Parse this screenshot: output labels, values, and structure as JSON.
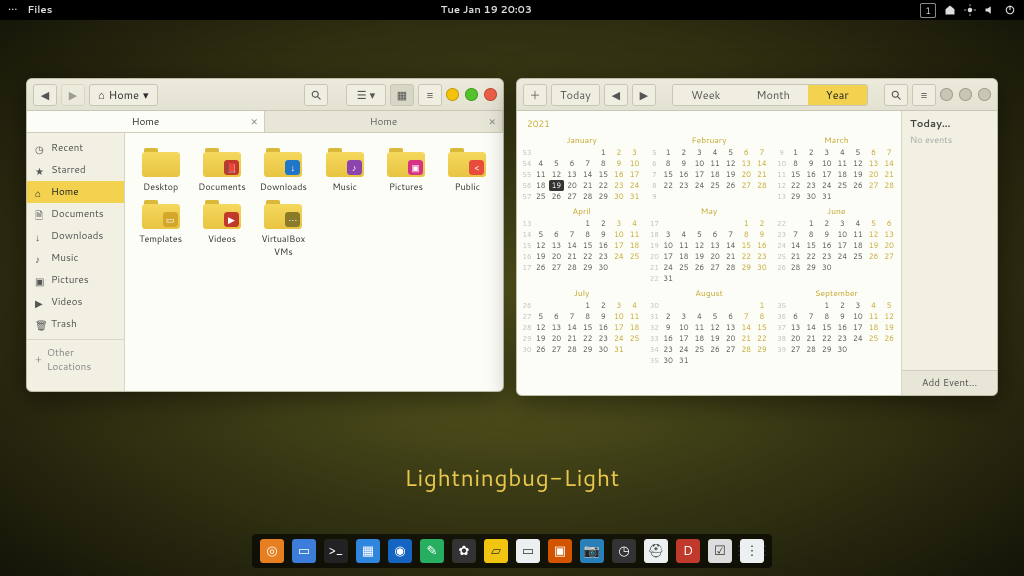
{
  "topbar": {
    "activities": "•••",
    "app": "Files",
    "clock": "Tue Jan 19  20:03",
    "workspace": "1"
  },
  "theme_name": "Lightningbug-Light",
  "files": {
    "path_label": "Home",
    "tabs": [
      {
        "label": "Home",
        "active": true
      },
      {
        "label": "Home",
        "active": false
      }
    ],
    "sidebar": [
      {
        "label": "Recent",
        "icon": "clock"
      },
      {
        "label": "Starred",
        "icon": "star"
      },
      {
        "label": "Home",
        "icon": "home",
        "selected": true
      },
      {
        "label": "Documents",
        "icon": "doc"
      },
      {
        "label": "Downloads",
        "icon": "down"
      },
      {
        "label": "Music",
        "icon": "music"
      },
      {
        "label": "Pictures",
        "icon": "pic"
      },
      {
        "label": "Videos",
        "icon": "vid"
      },
      {
        "label": "Trash",
        "icon": "trash"
      }
    ],
    "other_locations": "Other Locations",
    "folders": [
      {
        "name": "Desktop"
      },
      {
        "name": "Documents",
        "emblem": "#c0392b",
        "glyph": "📕"
      },
      {
        "name": "Downloads",
        "emblem": "#2176c7",
        "glyph": "↓"
      },
      {
        "name": "Music",
        "emblem": "#8e44ad",
        "glyph": "♪"
      },
      {
        "name": "Pictures",
        "emblem": "#d63384",
        "glyph": "▣"
      },
      {
        "name": "Public",
        "emblem": "#e74c3c",
        "glyph": "<"
      },
      {
        "name": "Templates",
        "emblem": "#d4a72c",
        "glyph": "▭"
      },
      {
        "name": "Videos",
        "emblem": "#c0392b",
        "glyph": "▶"
      },
      {
        "name": "VirtualBox VMs",
        "emblem": "#8a7a2a",
        "glyph": "⋯"
      }
    ]
  },
  "calendar": {
    "today_btn": "Today",
    "views": {
      "week": "Week",
      "month": "Month",
      "year": "Year",
      "selected": "year"
    },
    "year": "2021",
    "today_value": 19,
    "today_month": 0,
    "side_today": "Today...",
    "side_empty": "No events",
    "add_event": "Add Event…",
    "months": [
      "January",
      "February",
      "March",
      "April",
      "May",
      "June",
      "July",
      "August",
      "September"
    ],
    "month_specs": [
      {
        "days": 31,
        "start": 4,
        "wk": 53
      },
      {
        "days": 28,
        "start": 0,
        "wk": 5
      },
      {
        "days": 31,
        "start": 0,
        "wk": 9
      },
      {
        "days": 30,
        "start": 3,
        "wk": 13
      },
      {
        "days": 31,
        "start": 5,
        "wk": 17
      },
      {
        "days": 30,
        "start": 1,
        "wk": 22
      },
      {
        "days": 31,
        "start": 3,
        "wk": 26
      },
      {
        "days": 31,
        "start": 6,
        "wk": 30
      },
      {
        "days": 30,
        "start": 2,
        "wk": 35
      }
    ]
  },
  "dock_apps": [
    {
      "bg": "#e67e22",
      "g": "◎"
    },
    {
      "bg": "#3b7dd8",
      "g": "▭"
    },
    {
      "bg": "#222",
      "g": ">_"
    },
    {
      "bg": "#2e86de",
      "g": "▦"
    },
    {
      "bg": "#1565c0",
      "g": "◉"
    },
    {
      "bg": "#27ae60",
      "g": "✎"
    },
    {
      "bg": "#333",
      "g": "✿"
    },
    {
      "bg": "#f1c40f",
      "g": "▱"
    },
    {
      "bg": "#ecf0f1",
      "g": "▭"
    },
    {
      "bg": "#d35400",
      "g": "▣"
    },
    {
      "bg": "#2980b9",
      "g": "📷"
    },
    {
      "bg": "#333",
      "g": "◷"
    },
    {
      "bg": "#ecf0f1",
      "g": "⛑"
    },
    {
      "bg": "#c0392b",
      "g": "D"
    },
    {
      "bg": "#ddd",
      "g": "☑"
    },
    {
      "bg": "#ecf0f1",
      "g": "⋮⋮⋮"
    }
  ]
}
